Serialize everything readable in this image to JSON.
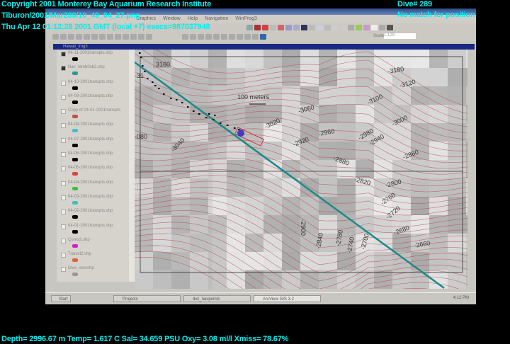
{
  "overlay": {
    "copyright": "Copyright 2001 Monterey Bay Aquarium Research Institute",
    "file": "Tiburon/2001/Mar289/10_49_04_27.png",
    "datetime": "Thu Apr 12 01:12:28 2001 GMT (local +7)  esecs=987037948",
    "dive": "Dive# 289",
    "position_status": "No match for position",
    "telemetry": "Depth= 2996.67 m  Temp= 1.617 C  Sal= 34.659 PSU  Oxy= 3.08 ml/l  Xmiss= 78.67%"
  },
  "app": {
    "menus": [
      "Graphics",
      "Window",
      "Help",
      "Navigation",
      "WinProg3"
    ],
    "scale_label": "Scale 1:",
    "scale_value": "1,129",
    "view_title": "Hawaii_Img3"
  },
  "legend": {
    "items": [
      {
        "label": "04-11-2001transpts.shp",
        "checked": true,
        "color": "#000000"
      },
      {
        "label": "Nav_tamb0sb2.shp",
        "checked": true,
        "color": "#2a9a9a"
      },
      {
        "label": "04-10-2001transpts.shp",
        "checked": false,
        "color": "#000000"
      },
      {
        "label": "04-09-2001transpts.shp",
        "checked": false,
        "color": "#000000"
      },
      {
        "label": "Copy of 04-01-2001transpts",
        "checked": false,
        "color": "#c05050"
      },
      {
        "label": "04-08-2001transpts.shp",
        "checked": false,
        "color": "#40c0d0"
      },
      {
        "label": "04-07-2001transpts.shp",
        "checked": false,
        "color": "#000000"
      },
      {
        "label": "04-06-2001transpts.shp",
        "checked": false,
        "color": "#000000"
      },
      {
        "label": "04-05-2001transpts.shp",
        "checked": false,
        "color": "#e04040"
      },
      {
        "label": "04-04-2001transpts.shp",
        "checked": false,
        "color": "#40c040"
      },
      {
        "label": "04-03-2001transpts.shp",
        "checked": false,
        "color": "#40c0c0"
      },
      {
        "label": "04-02-2001transpts.shp",
        "checked": false,
        "color": "#000000"
      },
      {
        "label": "04-01-2001transpts.shp",
        "checked": false,
        "color": "#000000"
      },
      {
        "label": "Cores2.shp",
        "checked": false,
        "color": "#d020d0"
      },
      {
        "label": "Transit2.shp",
        "checked": false,
        "color": "#e06040"
      },
      {
        "label": "Dive_overshp",
        "checked": false,
        "color": "#999999"
      }
    ]
  },
  "map": {
    "scale_bar": "100 meters",
    "contours": [
      "3160",
      "-3180",
      "-3120",
      "-3100",
      "-3060",
      "-3020",
      "-2960",
      "-3000",
      "-2980",
      "-2940",
      "-2920",
      "-3040",
      "-080",
      "-2880",
      "-2860",
      "-2820",
      "-2800",
      "-2760",
      "-2720",
      "-2680",
      "-2660",
      "-2900",
      "-2840",
      "-2780",
      "-2740",
      "-2700",
      "-31"
    ],
    "track_color": "#1a8a8a",
    "contour_color": "#c04040"
  },
  "taskbar": {
    "start": "Start",
    "tasks": [
      "Projects",
      "dvc_navpoints",
      "ArcView GIS 3.2"
    ],
    "clock": "4:12 PM"
  }
}
